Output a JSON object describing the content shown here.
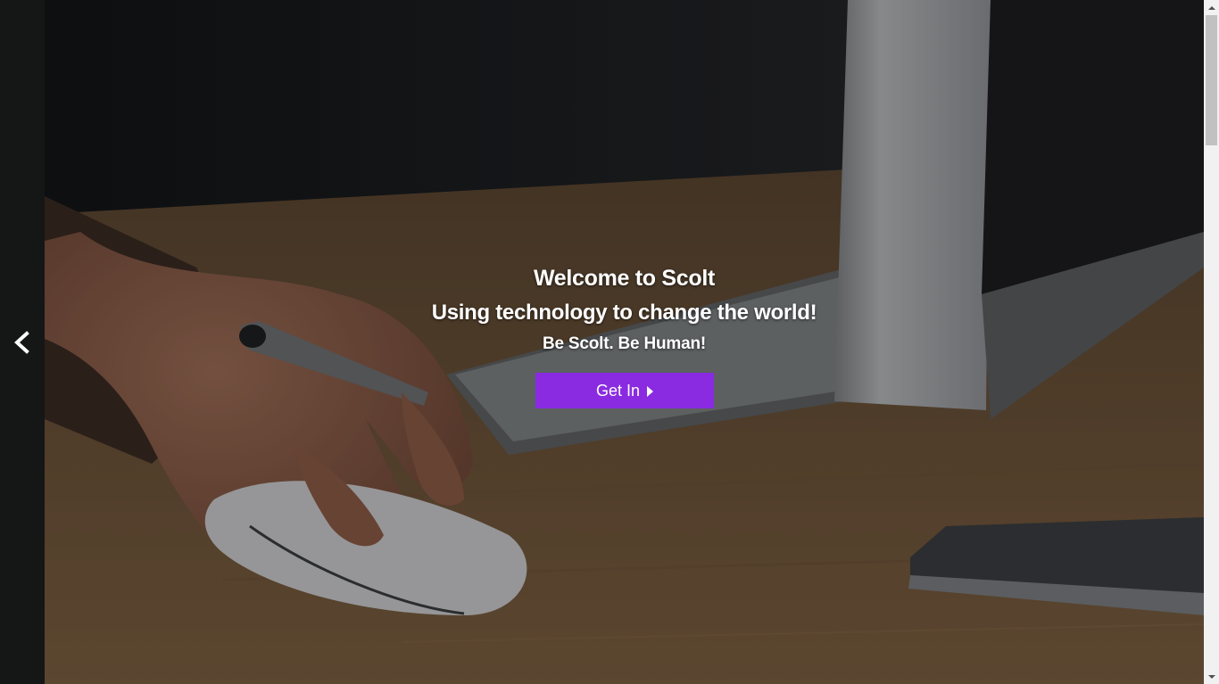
{
  "hero": {
    "title": "Welcome to Scolt",
    "subtitle": "Using technology to change the world!",
    "tagline": "Be Scolt. Be Human!",
    "cta_label": "Get In"
  },
  "navigation": {
    "prev_icon": "chevron-left-icon",
    "cta_icon": "caret-right-icon"
  },
  "colors": {
    "accent": "#8a2be2",
    "rail": "#151616",
    "text": "#ffffff"
  }
}
